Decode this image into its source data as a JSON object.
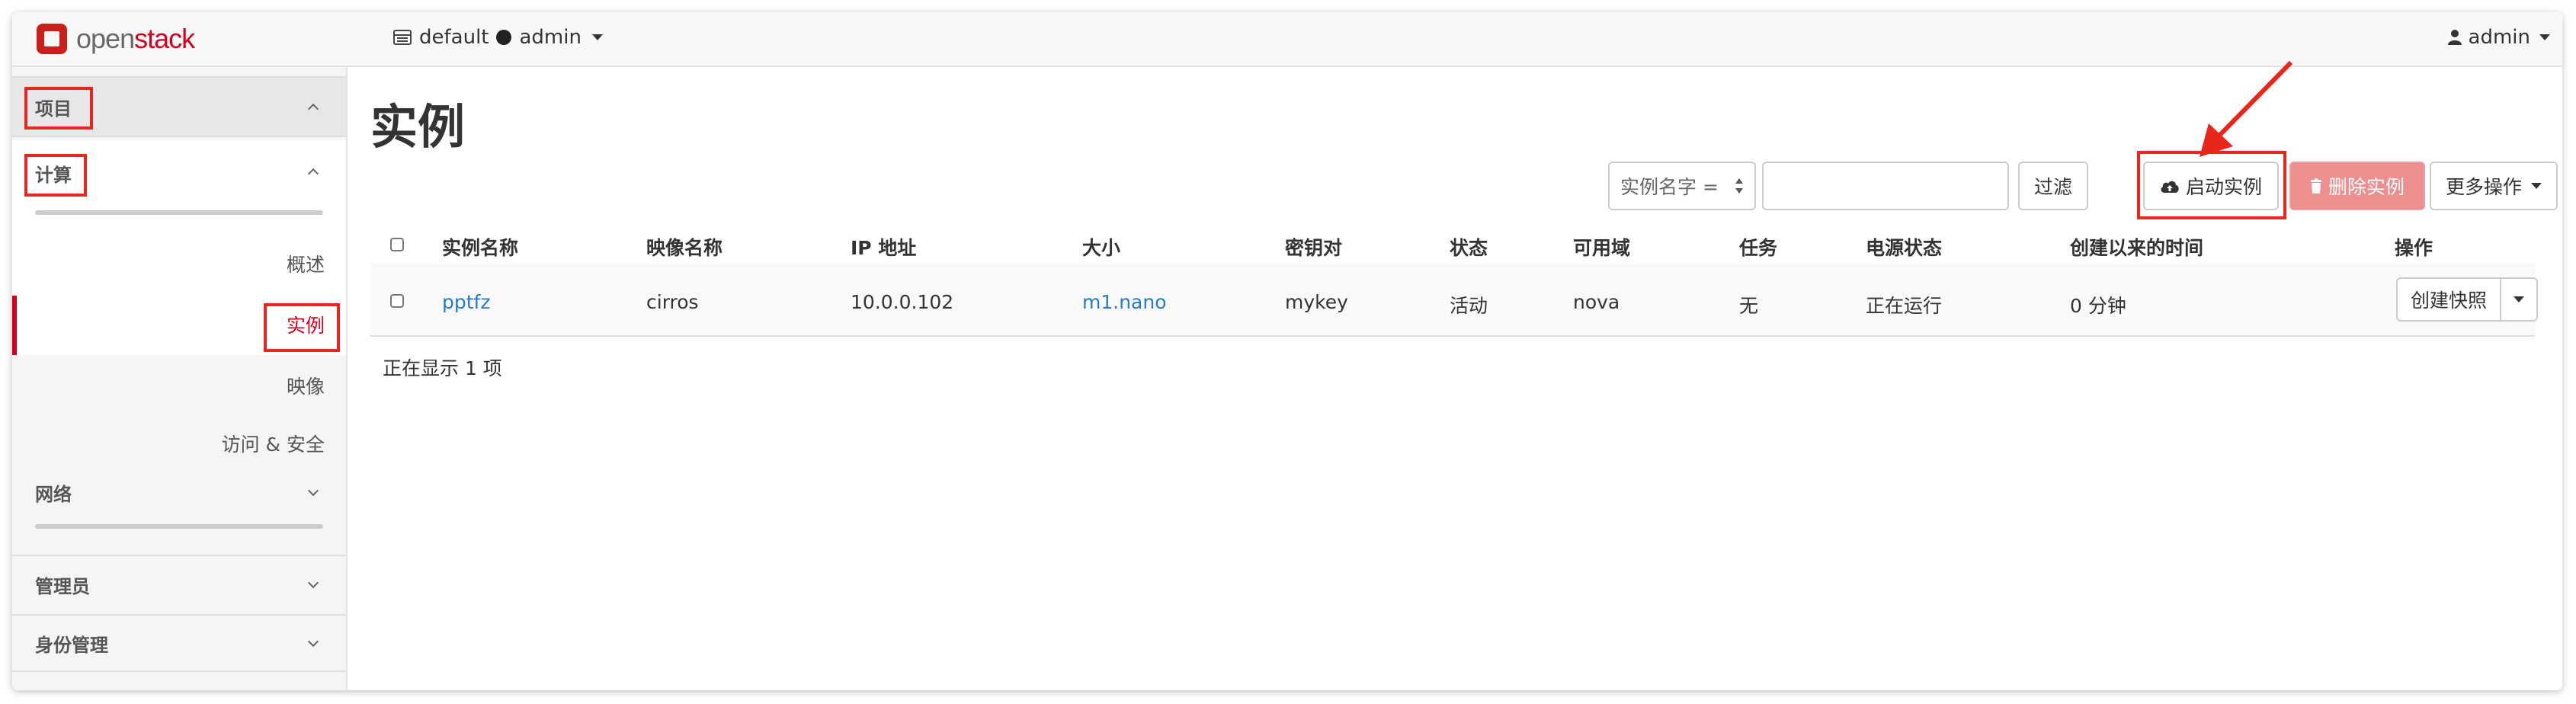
{
  "brand": {
    "name_prefix": "open",
    "name_suffix": "stack"
  },
  "navbar": {
    "domain": "default",
    "project": "admin",
    "user": "admin"
  },
  "sidebar": {
    "project": "项目",
    "compute": "计算",
    "compute_items": [
      "概述",
      "实例",
      "映像",
      "访问 & 安全"
    ],
    "network": "网络",
    "admin": "管理员",
    "identity": "身份管理"
  },
  "page": {
    "title": "实例",
    "filter_field": "实例名字 =",
    "filter_value": "",
    "filter_button": "过滤",
    "launch_button": "启动实例",
    "delete_button": "删除实例",
    "more_actions": "更多操作"
  },
  "table": {
    "headers": [
      "实例名称",
      "映像名称",
      "IP 地址",
      "大小",
      "密钥对",
      "状态",
      "可用域",
      "任务",
      "电源状态",
      "创建以来的时间",
      "操作"
    ],
    "rows": [
      {
        "name": "pptfz",
        "image": "cirros",
        "ip": "10.0.0.102",
        "size": "m1.nano",
        "keypair": "mykey",
        "status": "活动",
        "zone": "nova",
        "task": "无",
        "power": "正在运行",
        "age": "0 分钟",
        "action": "创建快照"
      }
    ],
    "footer": "正在显示 1 项"
  },
  "colors": {
    "accent": "#d0021b",
    "highlight": "#e8261c",
    "link": "#2a7ac3",
    "danger": "#ee8f8f"
  }
}
